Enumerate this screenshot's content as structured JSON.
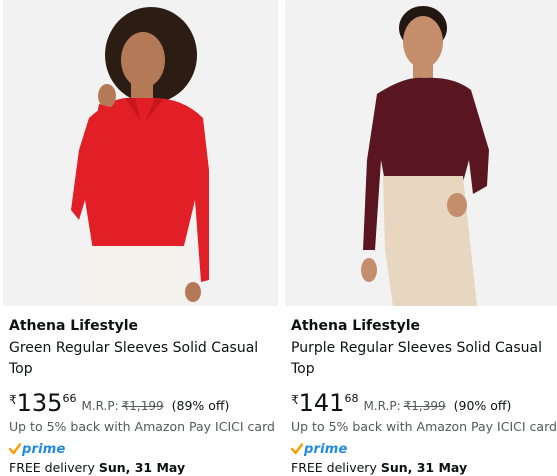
{
  "products": [
    {
      "brand": "Athena Lifestyle",
      "title": "Green Regular Sleeves Solid Casual Top",
      "currency": "₹",
      "price_whole": "135",
      "price_fraction": "66",
      "mrp_label": "M.R.P:",
      "mrp_value": "₹1,199",
      "discount": "(89% off)",
      "cashback": "Up to 5% back with Amazon Pay ICICI card",
      "prime_label": "prime",
      "delivery_prefix": "FREE delivery",
      "delivery_date": "Sun, 31 May",
      "image": {
        "top_color": "#e21f26",
        "pants_color": "#f3f1ec",
        "hair_color": "#2b1c14",
        "skin_color": "#b47a58"
      }
    },
    {
      "brand": "Athena Lifestyle",
      "title": "Purple Regular Sleeves Solid Casual Top",
      "currency": "₹",
      "price_whole": "141",
      "price_fraction": "68",
      "mrp_label": "M.R.P:",
      "mrp_value": "₹1,399",
      "discount": "(90% off)",
      "cashback": "Up to 5% back with Amazon Pay ICICI card",
      "prime_label": "prime",
      "delivery_prefix": "FREE delivery",
      "delivery_date": "Sun, 31 May",
      "image": {
        "top_color": "#5a1620",
        "pants_color": "#e7d7c1",
        "hair_color": "#221611",
        "skin_color": "#c48d6b"
      }
    }
  ],
  "colors": {
    "prime_blue": "#1f8adf",
    "prime_check": "#ff9900",
    "muted": "#565959"
  }
}
